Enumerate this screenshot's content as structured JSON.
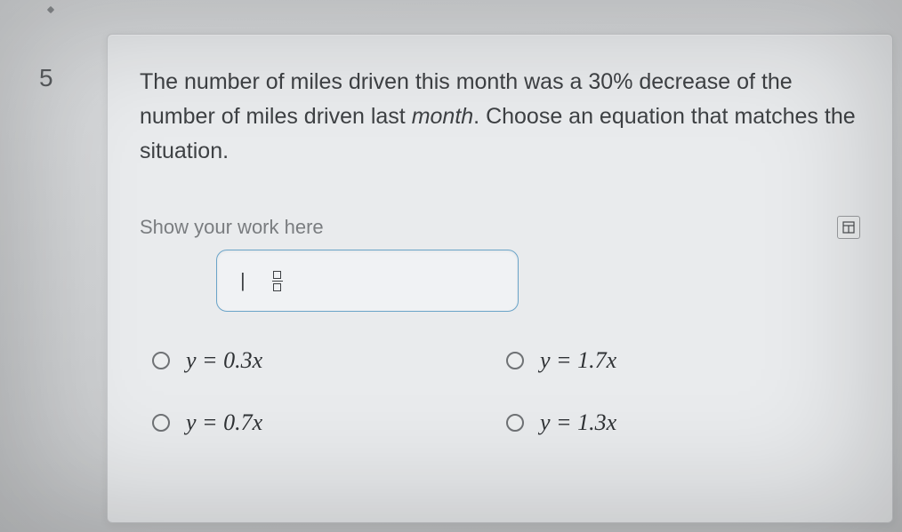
{
  "question": {
    "number": "5",
    "prompt_part1": "The number of miles driven this month was a 30% decrease of the number of miles driven last ",
    "prompt_italic": "month",
    "prompt_part2": ". Choose an equation that matches the situation."
  },
  "work": {
    "label": "Show your work here",
    "tool_minus": "|",
    "tool_frac_top": "",
    "tool_frac_bottom": ""
  },
  "options": {
    "a": "y = 0.3x",
    "b": "y = 1.7x",
    "c": "y = 0.7x",
    "d": "y = 1.3x"
  }
}
